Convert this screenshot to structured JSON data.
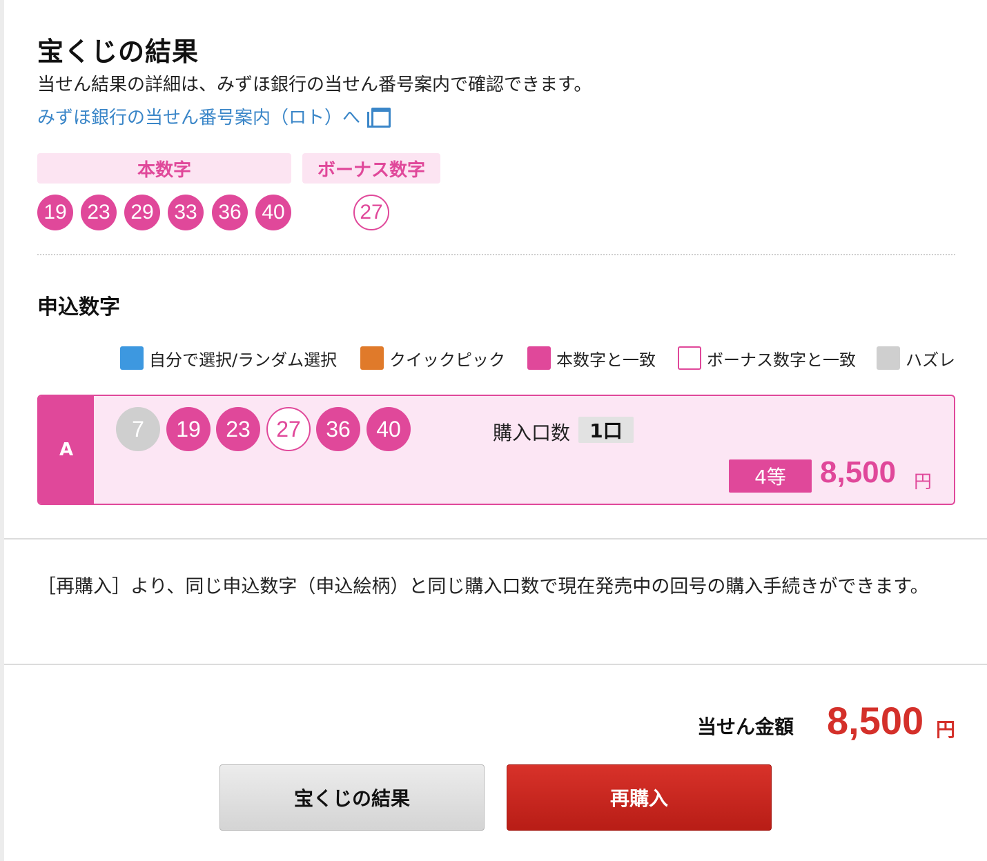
{
  "header": {
    "title": "宝くじの結果",
    "description": "当せん結果の詳細は、みずほ銀行の当せん番号案内で確認できます。",
    "link_label": "みずほ銀行の当せん番号案内（ロト）へ"
  },
  "winning": {
    "main_label": "本数字",
    "bonus_label": "ボーナス数字",
    "main_numbers": [
      "19",
      "23",
      "29",
      "33",
      "36",
      "40"
    ],
    "bonus_number": "27"
  },
  "entries_section": {
    "title": "申込数字",
    "legend": {
      "self_select": "自分で選択/ランダム選択",
      "quick_pick": "クイックピック",
      "main_match": "本数字と一致",
      "bonus_match": "ボーナス数字と一致",
      "miss": "ハズレ"
    },
    "legend_colors": {
      "self_select": "#3d98e0",
      "quick_pick": "#e07a2a",
      "main_match": "#e0489a",
      "bonus_match": "#ffffff",
      "miss": "#cfcfcf"
    }
  },
  "entry_a": {
    "letter": "A",
    "numbers": [
      "7",
      "19",
      "23",
      "27",
      "36",
      "40"
    ],
    "units_label": "購入口数",
    "units_value": "1口",
    "prize_grade": "4等",
    "prize_amount": "8,500",
    "prize_currency": "円"
  },
  "note": "［再購入］より、同じ申込数字（申込絵柄）と同じ購入口数で現在発売中の回号の購入手続きができます。",
  "total": {
    "label": "当せん金額",
    "amount": "8,500",
    "currency": "円"
  },
  "buttons": {
    "results": "宝くじの結果",
    "repurchase": "再購入"
  },
  "colors": {
    "accent_pink": "#e0489a",
    "pink_bg": "#fce6f4",
    "link_blue": "#3a86c8",
    "total_red": "#d4302a",
    "button_red": "#c8261e"
  }
}
